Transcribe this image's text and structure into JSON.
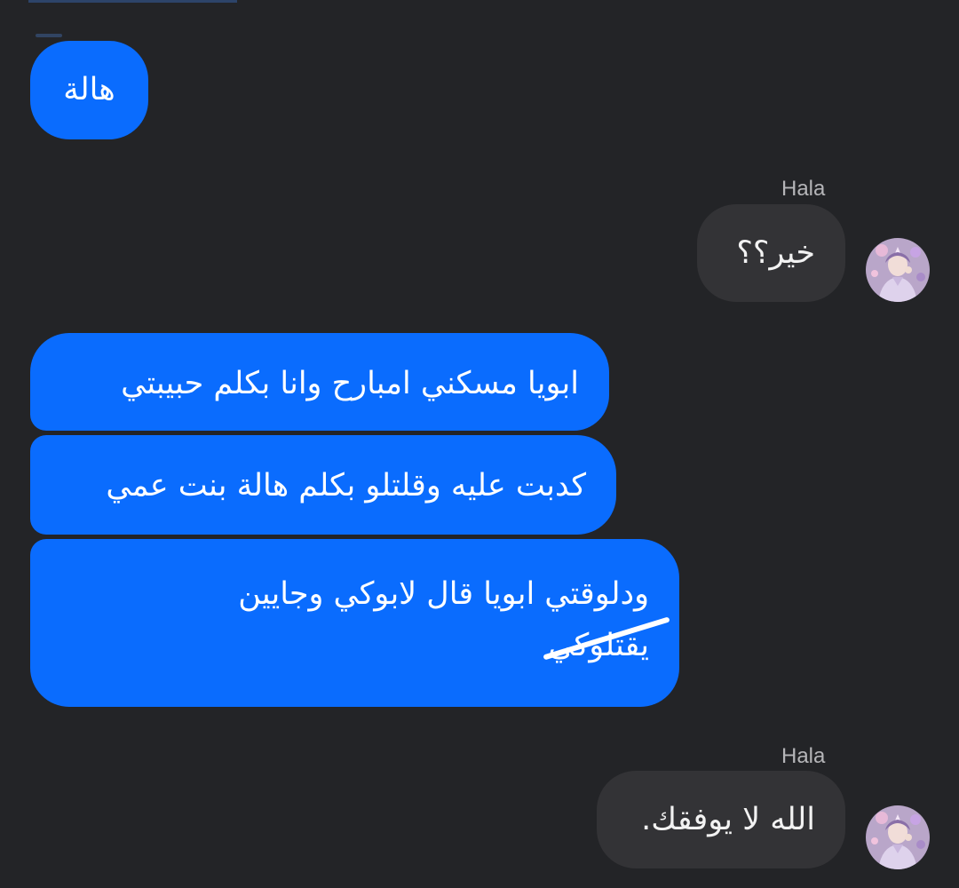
{
  "conversation": {
    "messages": [
      {
        "text": "هالة"
      },
      {
        "sender": "Hala",
        "text": "خير؟؟"
      },
      {
        "text": "ابويا مسكني امبارح وانا بكلم حبيبتي"
      },
      {
        "text": "كدبت عليه وقلتلو بكلم هالة بنت عمي"
      },
      {
        "line1": "ودلوقتي ابويا قال لابوكي وجايين",
        "line2": "يقتلوكي"
      },
      {
        "sender": "Hala",
        "text": "الله لا يوفقك."
      }
    ]
  },
  "colors": {
    "background": "#232427",
    "sent_bubble": "#0a6cfe",
    "received_bubble": "#333336",
    "sender_name": "#b5b5b8"
  },
  "icons": {
    "avatar": "profile-photo"
  }
}
